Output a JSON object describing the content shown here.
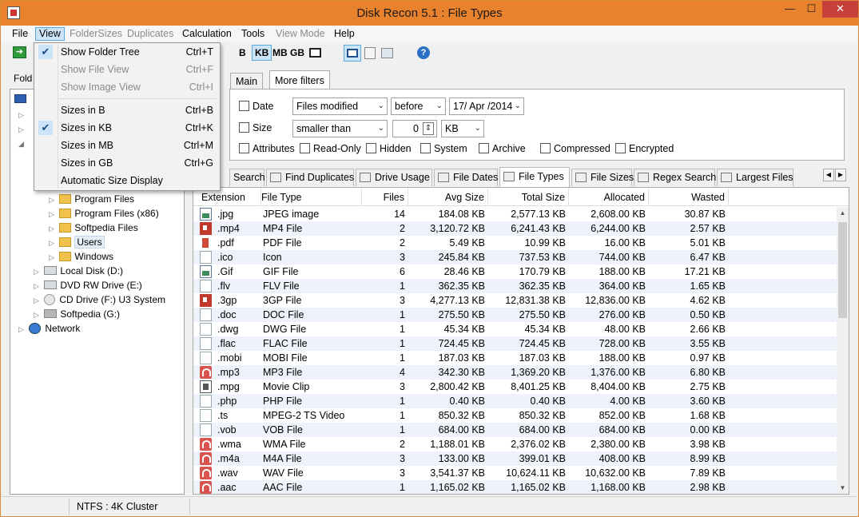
{
  "window": {
    "title": "Disk Recon 5.1 : File Types",
    "min": "—",
    "max": "☐",
    "close": "✕"
  },
  "menu": [
    {
      "label": "File",
      "disabled": false
    },
    {
      "label": "View",
      "disabled": false
    },
    {
      "label": "FolderSizes",
      "disabled": true
    },
    {
      "label": "Duplicates",
      "disabled": true
    },
    {
      "label": "Calculation",
      "disabled": false
    },
    {
      "label": "Tools",
      "disabled": false
    },
    {
      "label": "View Mode",
      "disabled": true
    },
    {
      "label": "Help",
      "disabled": false
    }
  ],
  "toolbar": {
    "b": "B",
    "kb": "KB",
    "mb": "MB",
    "gb": "GB",
    "selected_unit": "KB"
  },
  "left_label": "Fold",
  "view_menu": {
    "items": [
      {
        "label": "Show Folder Tree",
        "shortcut": "Ctrl+T",
        "checked": true,
        "disabled": false
      },
      {
        "label": "Show File View",
        "shortcut": "Ctrl+F",
        "checked": false,
        "disabled": true
      },
      {
        "label": "Show Image View",
        "shortcut": "Ctrl+I",
        "checked": false,
        "disabled": true
      },
      {
        "label": "Sizes in B",
        "shortcut": "Ctrl+B",
        "checked": false,
        "disabled": false
      },
      {
        "label": "Sizes in KB",
        "shortcut": "Ctrl+K",
        "checked": true,
        "disabled": false
      },
      {
        "label": "Sizes in MB",
        "shortcut": "Ctrl+M",
        "checked": false,
        "disabled": false
      },
      {
        "label": "Sizes in GB",
        "shortcut": "Ctrl+G",
        "checked": false,
        "disabled": false
      },
      {
        "label": "Automatic Size Display",
        "shortcut": "",
        "checked": false,
        "disabled": false
      }
    ]
  },
  "tree": {
    "items": [
      {
        "label": "Program Files",
        "icon": "folder"
      },
      {
        "label": "Program Files (x86)",
        "icon": "folder"
      },
      {
        "label": "Softpedia Files",
        "icon": "folder"
      },
      {
        "label": "Users",
        "icon": "folder",
        "selected": true
      },
      {
        "label": "Windows",
        "icon": "folder"
      },
      {
        "label": "Local Disk (D:)",
        "icon": "drive"
      },
      {
        "label": "DVD RW Drive (E:)",
        "icon": "dvd"
      },
      {
        "label": "CD Drive (F:) U3 System",
        "icon": "cd"
      },
      {
        "label": "Softpedia (G:)",
        "icon": "usb"
      },
      {
        "label": "Network",
        "icon": "network"
      }
    ]
  },
  "filter_tabs": {
    "main": "Main",
    "more": "More filters"
  },
  "filters": {
    "date_label": "Date",
    "date_field": "Files modified",
    "date_op": "before",
    "date_value": "17/ Apr /2014",
    "size_label": "Size",
    "size_op": "smaller than",
    "size_value": "0",
    "size_unit": "KB",
    "attributes_label": "Attributes",
    "attrs": [
      "Read-Only",
      "Hidden",
      "System",
      "Archive",
      "Compressed",
      "Encrypted"
    ]
  },
  "tabs": [
    {
      "label": "Search"
    },
    {
      "label": "Find Duplicates"
    },
    {
      "label": "Drive Usage"
    },
    {
      "label": "File Dates"
    },
    {
      "label": "File Types",
      "active": true
    },
    {
      "label": "File Sizes"
    },
    {
      "label": "Regex Search"
    },
    {
      "label": "Largest Files"
    }
  ],
  "grid": {
    "columns": [
      "Extension",
      "File Type",
      "Files",
      "Avg Size",
      "Total Size",
      "Allocated",
      "Wasted"
    ],
    "rows": [
      {
        "icon": "img",
        "ext": ".jpg",
        "type": "JPEG image",
        "files": "14",
        "avg": "184.08 KB",
        "total": "2,577.13 KB",
        "alloc": "2,608.00 KB",
        "wasted": "30.87 KB"
      },
      {
        "icon": "vid",
        "ext": ".mp4",
        "type": "MP4 File",
        "files": "2",
        "avg": "3,120.72 KB",
        "total": "6,241.43 KB",
        "alloc": "6,244.00 KB",
        "wasted": "2.57 KB"
      },
      {
        "icon": "pdf",
        "ext": ".pdf",
        "type": "PDF File",
        "files": "2",
        "avg": "5.49 KB",
        "total": "10.99 KB",
        "alloc": "16.00 KB",
        "wasted": "5.01 KB"
      },
      {
        "icon": "doc",
        "ext": ".ico",
        "type": "Icon",
        "files": "3",
        "avg": "245.84 KB",
        "total": "737.53 KB",
        "alloc": "744.00 KB",
        "wasted": "6.47 KB"
      },
      {
        "icon": "img",
        "ext": ".Gif",
        "type": "GIF File",
        "files": "6",
        "avg": "28.46 KB",
        "total": "170.79 KB",
        "alloc": "188.00 KB",
        "wasted": "17.21 KB"
      },
      {
        "icon": "doc",
        "ext": ".flv",
        "type": "FLV File",
        "files": "1",
        "avg": "362.35 KB",
        "total": "362.35 KB",
        "alloc": "364.00 KB",
        "wasted": "1.65 KB"
      },
      {
        "icon": "vid",
        "ext": ".3gp",
        "type": "3GP File",
        "files": "3",
        "avg": "4,277.13 KB",
        "total": "12,831.38 KB",
        "alloc": "12,836.00 KB",
        "wasted": "4.62 KB"
      },
      {
        "icon": "doc",
        "ext": ".doc",
        "type": "DOC File",
        "files": "1",
        "avg": "275.50 KB",
        "total": "275.50 KB",
        "alloc": "276.00 KB",
        "wasted": "0.50 KB"
      },
      {
        "icon": "doc",
        "ext": ".dwg",
        "type": "DWG File",
        "files": "1",
        "avg": "45.34 KB",
        "total": "45.34 KB",
        "alloc": "48.00 KB",
        "wasted": "2.66 KB"
      },
      {
        "icon": "doc",
        "ext": ".flac",
        "type": "FLAC File",
        "files": "1",
        "avg": "724.45 KB",
        "total": "724.45 KB",
        "alloc": "728.00 KB",
        "wasted": "3.55 KB"
      },
      {
        "icon": "doc",
        "ext": ".mobi",
        "type": "MOBI File",
        "files": "1",
        "avg": "187.03 KB",
        "total": "187.03 KB",
        "alloc": "188.00 KB",
        "wasted": "0.97 KB"
      },
      {
        "icon": "aud",
        "ext": ".mp3",
        "type": "MP3 File",
        "files": "4",
        "avg": "342.30 KB",
        "total": "1,369.20 KB",
        "alloc": "1,376.00 KB",
        "wasted": "6.80 KB"
      },
      {
        "icon": "mpg",
        "ext": ".mpg",
        "type": "Movie Clip",
        "files": "3",
        "avg": "2,800.42 KB",
        "total": "8,401.25 KB",
        "alloc": "8,404.00 KB",
        "wasted": "2.75 KB"
      },
      {
        "icon": "doc",
        "ext": ".php",
        "type": "PHP File",
        "files": "1",
        "avg": "0.40 KB",
        "total": "0.40 KB",
        "alloc": "4.00 KB",
        "wasted": "3.60 KB"
      },
      {
        "icon": "doc",
        "ext": ".ts",
        "type": "MPEG-2 TS Video",
        "files": "1",
        "avg": "850.32 KB",
        "total": "850.32 KB",
        "alloc": "852.00 KB",
        "wasted": "1.68 KB"
      },
      {
        "icon": "doc",
        "ext": ".vob",
        "type": "VOB File",
        "files": "1",
        "avg": "684.00 KB",
        "total": "684.00 KB",
        "alloc": "684.00 KB",
        "wasted": "0.00 KB"
      },
      {
        "icon": "aud",
        "ext": ".wma",
        "type": "WMA File",
        "files": "2",
        "avg": "1,188.01 KB",
        "total": "2,376.02 KB",
        "alloc": "2,380.00 KB",
        "wasted": "3.98 KB"
      },
      {
        "icon": "aud",
        "ext": ".m4a",
        "type": "M4A File",
        "files": "3",
        "avg": "133.00 KB",
        "total": "399.01 KB",
        "alloc": "408.00 KB",
        "wasted": "8.99 KB"
      },
      {
        "icon": "aud",
        "ext": ".wav",
        "type": "WAV File",
        "files": "3",
        "avg": "3,541.37 KB",
        "total": "10,624.11 KB",
        "alloc": "10,632.00 KB",
        "wasted": "7.89 KB"
      },
      {
        "icon": "aud",
        "ext": ".aac",
        "type": "AAC File",
        "files": "1",
        "avg": "1,165.02 KB",
        "total": "1,165.02 KB",
        "alloc": "1,168.00 KB",
        "wasted": "2.98 KB"
      }
    ]
  },
  "status": {
    "cluster": "NTFS : 4K Cluster"
  }
}
